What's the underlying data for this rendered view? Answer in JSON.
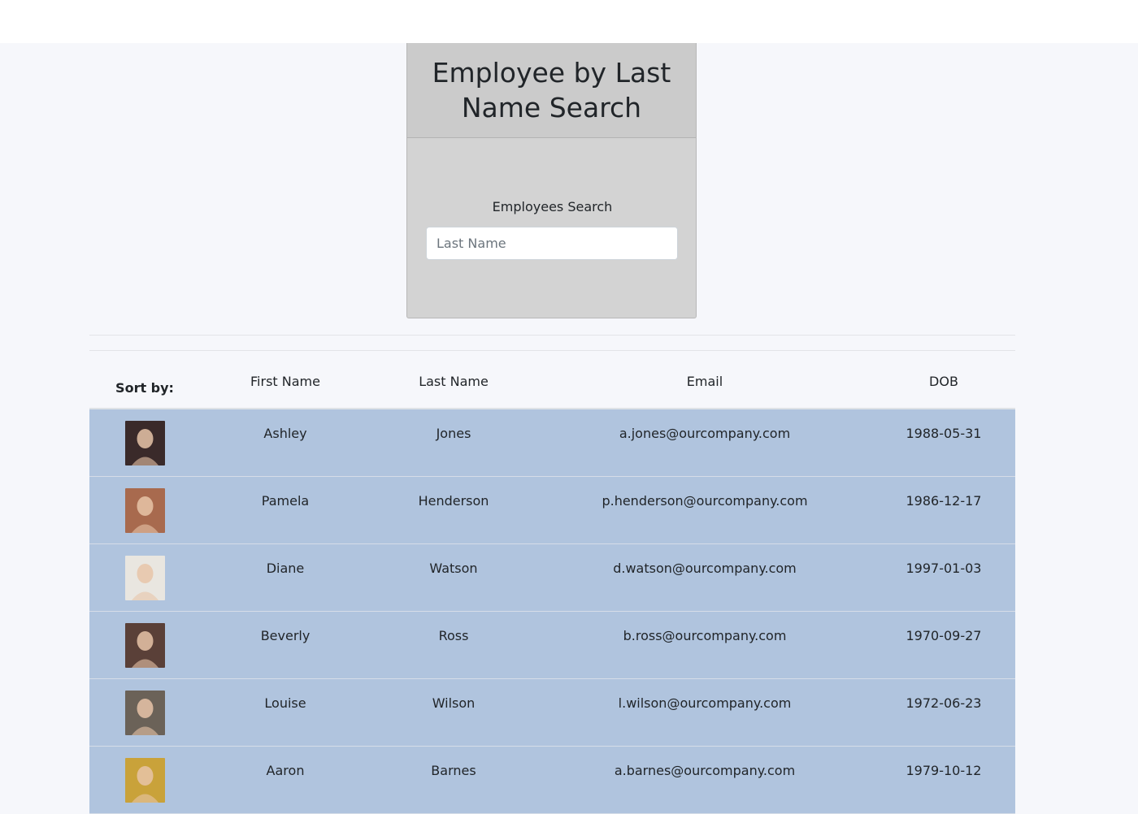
{
  "header": {
    "title": "Employee by Last Name Search"
  },
  "search": {
    "label": "Employees Search",
    "placeholder": "Last Name",
    "value": ""
  },
  "table": {
    "sort_label": "Sort by:",
    "columns": [
      "First Name",
      "Last Name",
      "Email",
      "DOB"
    ],
    "rows": [
      {
        "first": "Ashley",
        "last": "Jones",
        "email": "a.jones@ourcompany.com",
        "dob": "1988-05-31",
        "avatar_color": "#3a2a2a"
      },
      {
        "first": "Pamela",
        "last": "Henderson",
        "email": "p.henderson@ourcompany.com",
        "dob": "1986-12-17",
        "avatar_color": "#a86a4e"
      },
      {
        "first": "Diane",
        "last": "Watson",
        "email": "d.watson@ourcompany.com",
        "dob": "1997-01-03",
        "avatar_color": "#e9e6e0"
      },
      {
        "first": "Beverly",
        "last": "Ross",
        "email": "b.ross@ourcompany.com",
        "dob": "1970-09-27",
        "avatar_color": "#5a4038"
      },
      {
        "first": "Louise",
        "last": "Wilson",
        "email": "l.wilson@ourcompany.com",
        "dob": "1972-06-23",
        "avatar_color": "#6b6258"
      },
      {
        "first": "Aaron",
        "last": "Barnes",
        "email": "a.barnes@ourcompany.com",
        "dob": "1979-10-12",
        "avatar_color": "#c9a23a"
      }
    ]
  },
  "colors": {
    "row_bg": "#b0c4de",
    "card_bg": "#d3d3d3",
    "card_header_bg": "#cbcbcb",
    "page_bg": "#f6f7fb"
  }
}
